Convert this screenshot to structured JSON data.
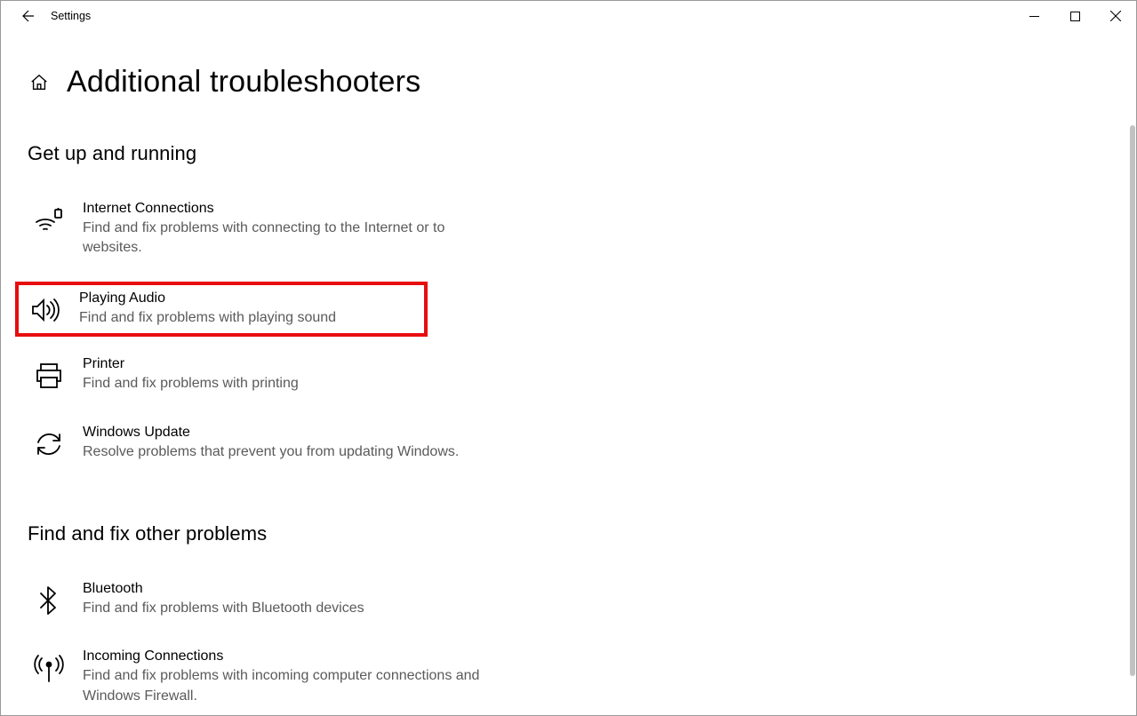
{
  "window": {
    "app_title": "Settings"
  },
  "page": {
    "title": "Additional troubleshooters"
  },
  "sections": {
    "get_up": {
      "title": "Get up and running",
      "items": [
        {
          "title": "Internet Connections",
          "desc": "Find and fix problems with connecting to the Internet or to websites."
        },
        {
          "title": "Playing Audio",
          "desc": "Find and fix problems with playing sound"
        },
        {
          "title": "Printer",
          "desc": "Find and fix problems with printing"
        },
        {
          "title": "Windows Update",
          "desc": "Resolve problems that prevent you from updating Windows."
        }
      ]
    },
    "find_fix": {
      "title": "Find and fix other problems",
      "items": [
        {
          "title": "Bluetooth",
          "desc": "Find and fix problems with Bluetooth devices"
        },
        {
          "title": "Incoming Connections",
          "desc": "Find and fix problems with incoming computer connections and Windows Firewall."
        }
      ]
    }
  }
}
